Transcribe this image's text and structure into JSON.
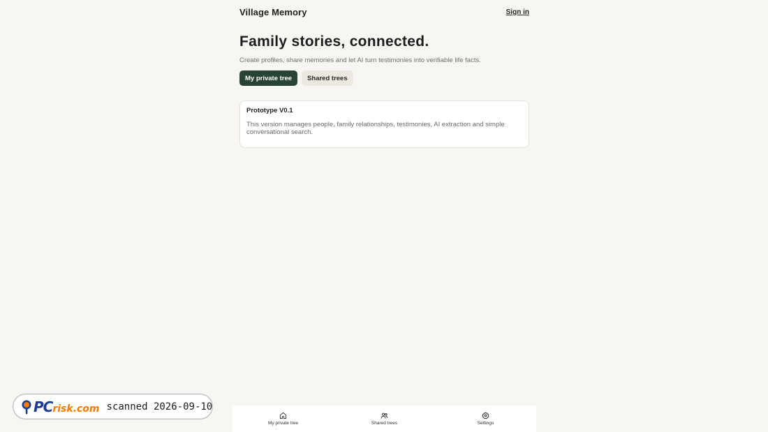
{
  "header": {
    "brand": "Village Memory",
    "sign_in_label": "Sign in"
  },
  "hero": {
    "title": "Family stories, connected.",
    "subtitle": "Create profiles, share memories and let AI turn testimonies into verifiable life facts."
  },
  "tabs": [
    {
      "label": "My private tree",
      "active": true
    },
    {
      "label": "Shared trees",
      "active": false
    }
  ],
  "card": {
    "title": "Prototype V0.1",
    "body": "This version manages people, family relationships, testimonies, AI extraction and simple conversational search."
  },
  "bottom_nav": [
    {
      "label": "My private tree",
      "icon": "home-icon"
    },
    {
      "label": "Shared trees",
      "icon": "users-icon"
    },
    {
      "label": "Settings",
      "icon": "gear-icon"
    }
  ],
  "watermark": {
    "logo_main": "PC",
    "logo_suffix": "risk.com",
    "stamp": "scanned 2026-09-10"
  },
  "colors": {
    "background": "#f8f6f2",
    "accent": "#294236",
    "logo_blue": "#1b3c8f",
    "logo_orange": "#f07d00"
  }
}
